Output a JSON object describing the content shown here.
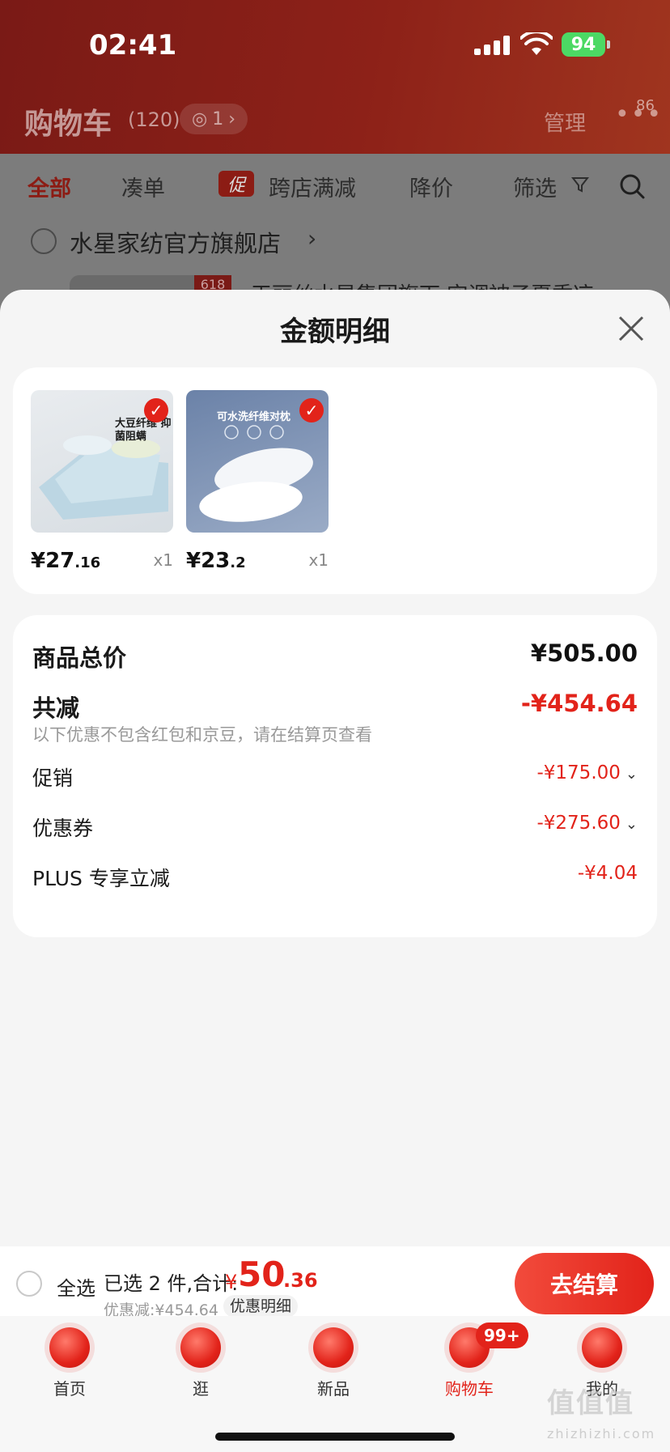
{
  "status_bar": {
    "time": "02:41",
    "battery": "94"
  },
  "cart_header": {
    "title": "购物车",
    "count": "(120)",
    "watch_count": "1",
    "manage": "管理",
    "more_badge": "86"
  },
  "filters": {
    "all": "全部",
    "bundle": "凑单",
    "promo_tag": "促",
    "cross_store": "跨店满减",
    "price_drop": "降价",
    "filter": "筛选"
  },
  "store": {
    "name": "水星家纺官方旗舰店",
    "tag": "618",
    "product_title_partial": "天丽丝水星集团旗下 空调被子夏季凉"
  },
  "sheet": {
    "title": "金额明细",
    "products": [
      {
        "price_int": "¥27",
        "price_dec": ".16",
        "qty": "x1",
        "caption": "大豆纤维 抑菌阻螨"
      },
      {
        "price_int": "¥23",
        "price_dec": ".2",
        "qty": "x1",
        "caption": "可水洗纤维对枕"
      }
    ],
    "summary": {
      "total_label": "商品总价",
      "total_value": "¥505.00",
      "reduce_label": "共减",
      "reduce_value": "-¥454.64",
      "note": "以下优惠不包含红包和京豆，请在结算页查看",
      "promo_label": "促销",
      "promo_value": "-¥175.00",
      "coupon_label": "优惠券",
      "coupon_value": "-¥275.60",
      "plus_label": "PLUS 专享立减",
      "plus_value": "-¥4.04"
    }
  },
  "checkout": {
    "select_all": "全选",
    "selected": "已选 2 件,合计:",
    "currency": "¥",
    "total_int": "50",
    "total_dec": ".36",
    "discount": "优惠减:¥454.64",
    "detail": "优惠明细",
    "button": "去结算"
  },
  "tabs": [
    {
      "label": "首页"
    },
    {
      "label": "逛"
    },
    {
      "label": "新品"
    },
    {
      "label": "购物车",
      "badge": "99+"
    },
    {
      "label": "我的"
    }
  ],
  "watermark": {
    "main": "值值值",
    "sub": "zhizhizhi.com"
  },
  "colors": {
    "accent": "#e2231a",
    "header_bg": "#8d2118"
  }
}
